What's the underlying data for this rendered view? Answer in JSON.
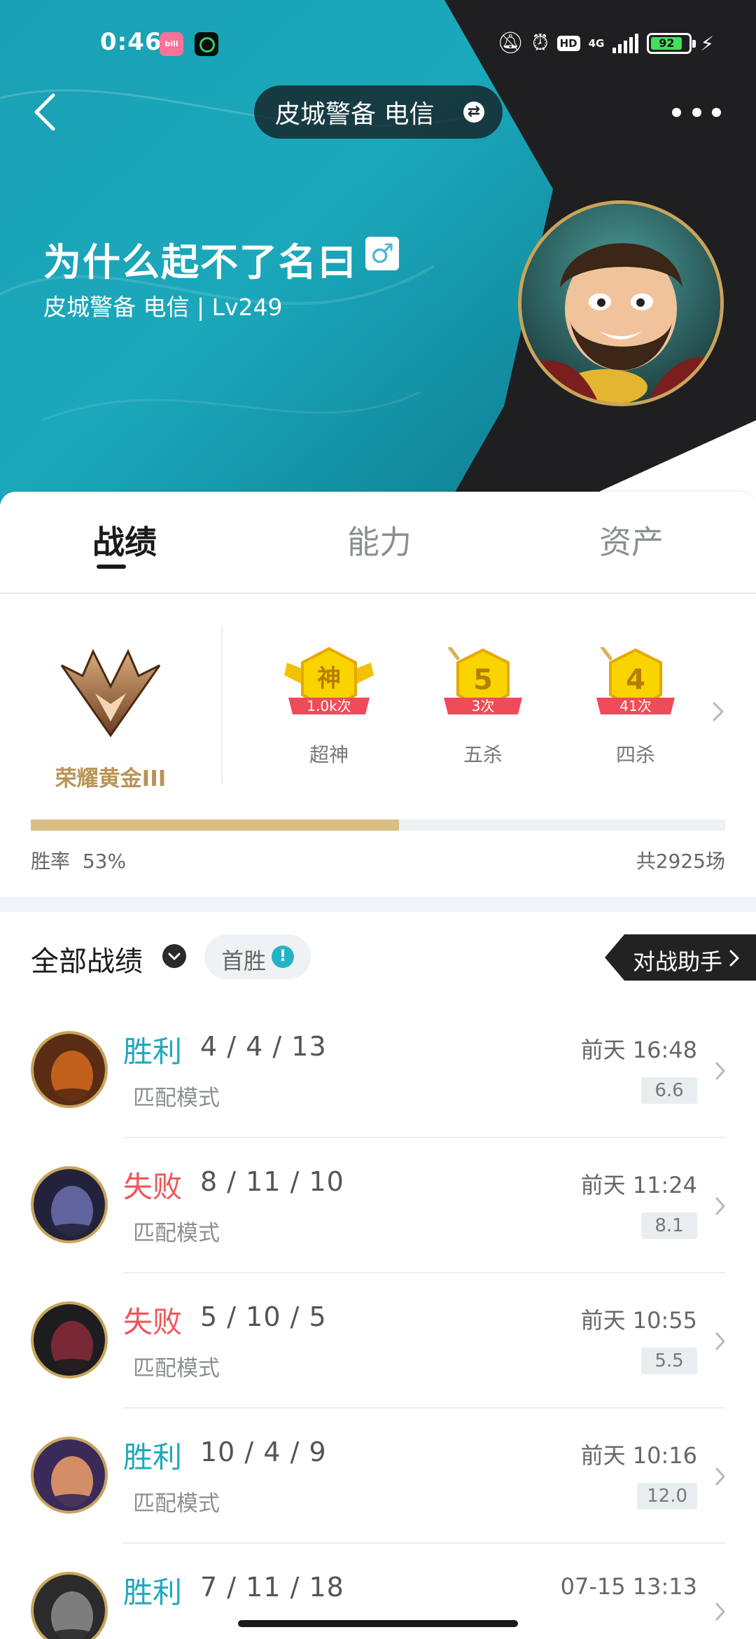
{
  "status_bar": {
    "time": "0:46",
    "app1_label": "bili",
    "icons": [
      "mute-bell-icon",
      "alarm-icon",
      "hd-icon",
      "4g-signal-icon",
      "battery-icon",
      "charging-icon"
    ],
    "hd": "HD",
    "network": "4G",
    "battery": "92"
  },
  "header": {
    "server": "皮城警备 电信",
    "player_name": "为什么起不了名曰",
    "gender_symbol": "♂",
    "subtitle": "皮城警备 电信 | Lv249"
  },
  "tabs": [
    {
      "label": "战绩",
      "active": true
    },
    {
      "label": "能力",
      "active": false
    },
    {
      "label": "资产",
      "active": false
    }
  ],
  "rank": {
    "label": "荣耀黄金III"
  },
  "medals": [
    {
      "glyph": "神",
      "count": "1.0k次",
      "label": "超神"
    },
    {
      "glyph": "5",
      "count": "3次",
      "label": "五杀"
    },
    {
      "glyph": "4",
      "count": "41次",
      "label": "四杀"
    }
  ],
  "win_stats": {
    "win_rate_label": "胜率",
    "win_rate": "53%",
    "win_rate_value": 0.53,
    "total": "共2925场"
  },
  "records": {
    "title": "全部战绩",
    "first_win": "首胜",
    "assistant": "对战助手"
  },
  "matches": [
    {
      "result": "胜利",
      "outcome": "win",
      "kda": "4 / 4 / 13",
      "mode": "匹配模式",
      "time": "前天 16:48",
      "score": "6.6"
    },
    {
      "result": "失败",
      "outcome": "loss",
      "kda": "8 / 11 / 10",
      "mode": "匹配模式",
      "time": "前天 11:24",
      "score": "8.1"
    },
    {
      "result": "失败",
      "outcome": "loss",
      "kda": "5 / 10 / 5",
      "mode": "匹配模式",
      "time": "前天 10:55",
      "score": "5.5"
    },
    {
      "result": "胜利",
      "outcome": "win",
      "kda": "10 / 4 / 9",
      "mode": "匹配模式",
      "time": "前天 10:16",
      "score": "12.0"
    },
    {
      "result": "胜利",
      "outcome": "win",
      "kda": "7 / 11 / 18",
      "mode": "",
      "time": "07-15 13:13",
      "score": ""
    }
  ],
  "colors": {
    "win": "#1ea8bd",
    "loss": "#f0555a",
    "gold": "#c9a45a",
    "winbar": "#d8bf86"
  }
}
